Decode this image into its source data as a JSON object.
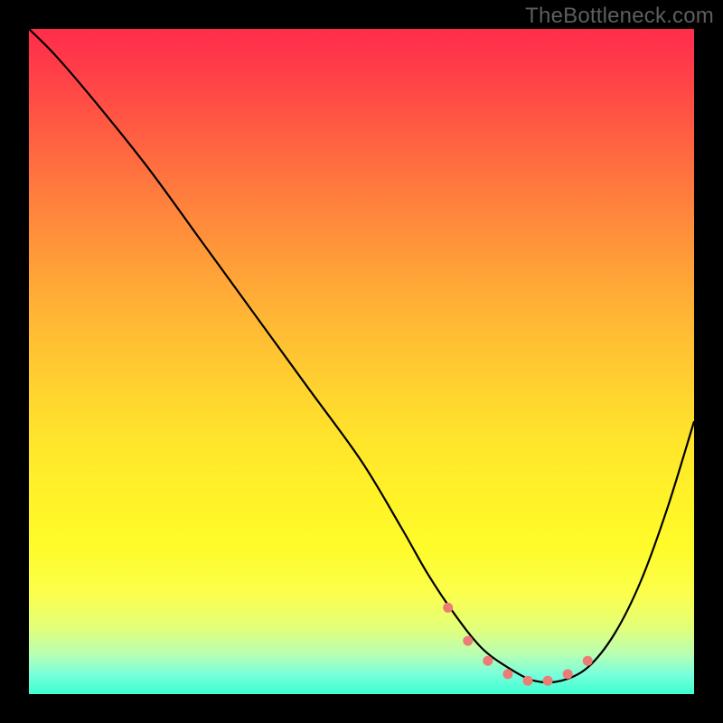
{
  "watermark": "TheBottleneck.com",
  "chart_data": {
    "type": "line",
    "title": "",
    "xlabel": "",
    "ylabel": "",
    "xlim": [
      0,
      100
    ],
    "ylim": [
      0,
      100
    ],
    "grid": false,
    "legend": false,
    "colors": {
      "gradient_top": "#ff2d4a",
      "gradient_mid": "#ffe52b",
      "gradient_bottom": "#3cffd0",
      "curve": "#000000",
      "markers": "#ec7d76",
      "frame": "#000000"
    },
    "series": [
      {
        "name": "bottleneck-curve",
        "x": [
          0,
          4,
          10,
          18,
          26,
          34,
          42,
          50,
          56,
          60,
          64,
          68,
          72,
          76,
          80,
          84,
          88,
          92,
          96,
          100
        ],
        "y": [
          100,
          96,
          89,
          79,
          68,
          57,
          46,
          35,
          25,
          18,
          12,
          7,
          4,
          2,
          2,
          4,
          9,
          17,
          28,
          41
        ]
      }
    ],
    "markers": {
      "name": "highlight-range",
      "x": [
        63,
        66,
        69,
        72,
        75,
        78,
        81,
        84
      ],
      "y": [
        13,
        8,
        5,
        3,
        2,
        2,
        3,
        5
      ]
    }
  }
}
